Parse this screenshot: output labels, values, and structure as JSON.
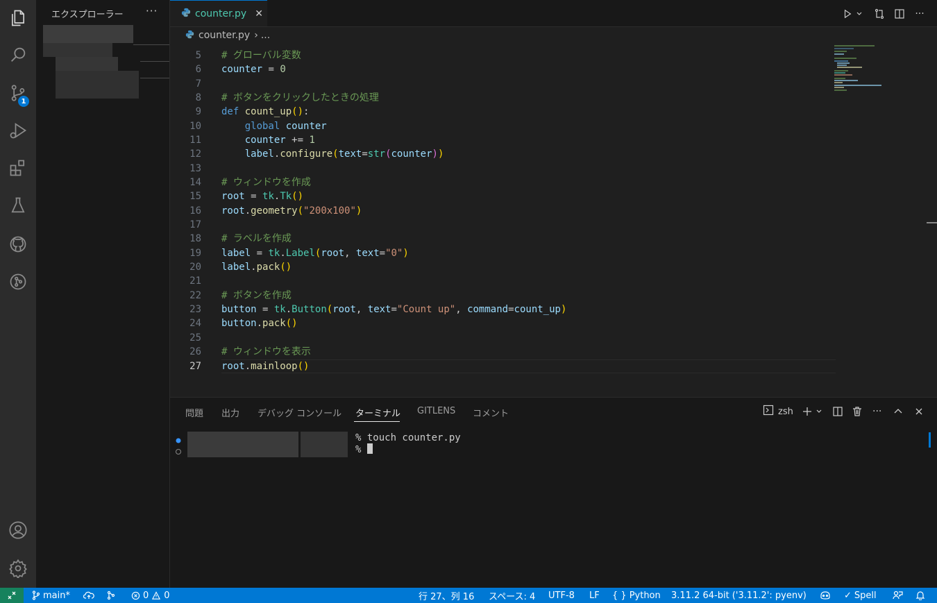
{
  "sidebar": {
    "title": "エクスプローラー",
    "more": "···"
  },
  "activity": {
    "scm_badge": "1"
  },
  "editor": {
    "tab_label": "counter.py",
    "tab_close": "✕",
    "breadcrumb_file": "counter.py",
    "breadcrumb_sep": "›",
    "breadcrumb_more": "...",
    "more": "···",
    "line_numbers": [
      "5",
      "6",
      "7",
      "8",
      "9",
      "10",
      "11",
      "12",
      "13",
      "14",
      "15",
      "16",
      "17",
      "18",
      "19",
      "20",
      "21",
      "22",
      "23",
      "24",
      "25",
      "26",
      "27"
    ],
    "comments": {
      "l5": "# グローバル変数",
      "l8": "# ボタンをクリックしたときの処理",
      "l14": "# ウィンドウを作成",
      "l18": "# ラベルを作成",
      "l22": "# ボタンを作成",
      "l26": "# ウィンドウを表示"
    },
    "code_lines": [
      "# グローバル変数",
      "counter = 0",
      "",
      "# ボタンをクリックしたときの処理",
      "def count_up():",
      "    global counter",
      "    counter += 1",
      "    label.configure(text=str(counter))",
      "",
      "# ウィンドウを作成",
      "root = tk.Tk()",
      "root.geometry(\"200x100\")",
      "",
      "# ラベルを作成",
      "label = tk.Label(root, text=\"0\")",
      "label.pack()",
      "",
      "# ボタンを作成",
      "button = tk.Button(root, text=\"Count up\", command=count_up)",
      "button.pack()",
      "",
      "# ウィンドウを表示",
      "root.mainloop()"
    ]
  },
  "panel": {
    "tabs": [
      "問題",
      "出力",
      "デバッグ コンソール",
      "ターミナル",
      "GITLENS",
      "コメント"
    ],
    "active_tab": "ターミナル",
    "shell": "zsh",
    "more": "···",
    "terminal_lines": [
      "% touch counter.py",
      "% "
    ]
  },
  "status": {
    "branch": "main*",
    "errors": "0",
    "warnings": "0",
    "position": "行 27、列 16",
    "indent": "スペース: 4",
    "encoding": "UTF-8",
    "eol": "LF",
    "language": "Python",
    "interpreter": "3.11.2 64-bit ('3.11.2': pyenv)",
    "spell": "Spell"
  }
}
